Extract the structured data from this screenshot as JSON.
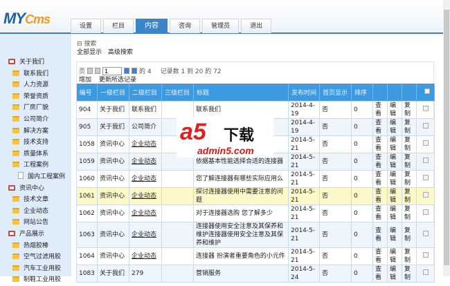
{
  "logo": {
    "my": "MY",
    "cms": "Cms"
  },
  "tabs": [
    "设置",
    "栏目",
    "内容",
    "咨询",
    "管理员",
    "退出"
  ],
  "sidebar": [
    {
      "label": "关于我们",
      "level": 1,
      "icon": "monitor-icon"
    },
    {
      "label": "联系我们",
      "level": 2,
      "icon": "folder-icon"
    },
    {
      "label": "人力资源",
      "level": 2,
      "icon": "folder-icon"
    },
    {
      "label": "荣誉资质",
      "level": 2,
      "icon": "folder-icon"
    },
    {
      "label": "厂房厂貌",
      "level": 2,
      "icon": "folder-icon"
    },
    {
      "label": "公司简介",
      "level": 2,
      "icon": "folder-icon"
    },
    {
      "label": "解决方案",
      "level": 2,
      "icon": "folder-icon"
    },
    {
      "label": "技术支持",
      "level": 2,
      "icon": "folder-icon"
    },
    {
      "label": "质量体系",
      "level": 2,
      "icon": "folder-icon"
    },
    {
      "label": "工程案例",
      "level": 2,
      "icon": "folder-icon"
    },
    {
      "label": "国内工程案例",
      "level": 3,
      "icon": "document-icon"
    },
    {
      "label": "资讯中心",
      "level": 1,
      "icon": "monitor-icon"
    },
    {
      "label": "技术文章",
      "level": 2,
      "icon": "folder-icon"
    },
    {
      "label": "企业动态",
      "level": 2,
      "icon": "folder-icon"
    },
    {
      "label": "网站公告",
      "level": 2,
      "icon": "folder-icon"
    },
    {
      "label": "产品展示",
      "level": 1,
      "icon": "monitor-icon"
    },
    {
      "label": "热熔胶棒",
      "level": 2,
      "icon": "folder-icon"
    },
    {
      "label": "空气过滤用胶",
      "level": 2,
      "icon": "folder-icon"
    },
    {
      "label": "汽车工业用胶",
      "level": 2,
      "icon": "folder-icon"
    },
    {
      "label": "制鞋工业用胶",
      "level": 2,
      "icon": "folder-icon"
    }
  ],
  "search": {
    "toggle": "⊟ 搜索",
    "show_all": "全部显示",
    "advanced": "高级搜索"
  },
  "pager": {
    "page_label": "页",
    "page": "1",
    "of": "的 4",
    "records": "记录数 1 到 20 的 72"
  },
  "actions": {
    "add": "增加",
    "update": "更新所选记录"
  },
  "table": {
    "headers": [
      "编号",
      "一级栏目",
      "二级栏目",
      "三级栏目",
      "标题",
      "发布时间",
      "首页显示",
      "排序",
      "",
      "",
      "",
      ""
    ],
    "rows": [
      {
        "id": "904",
        "c1": "关于我们",
        "c2": "联系我们",
        "c3": "",
        "title": "联系我们",
        "date": "2014-4-19",
        "home": "否",
        "order": "0"
      },
      {
        "id": "905",
        "c1": "关于我们",
        "c2": "公司简介",
        "c3": "",
        "title": "",
        "date": "2014-4-19",
        "home": "否",
        "order": "0"
      },
      {
        "id": "1058",
        "c1": "资讯中心",
        "c2": "企业动态",
        "c3": "",
        "title": "连",
        "date": "2014-5-21",
        "home": "否",
        "order": "0"
      },
      {
        "id": "1059",
        "c1": "资讯中心",
        "c2": "企业动态",
        "c3": "",
        "title": "依据基本性能选择合适的连接器",
        "date": "2014-5-21",
        "home": "否",
        "order": "0"
      },
      {
        "id": "1060",
        "c1": "资讯中心",
        "c2": "企业动态",
        "c3": "",
        "title": "您了解连接器有哪些实际应用么",
        "date": "2014-5-21",
        "home": "否",
        "order": "0"
      },
      {
        "id": "1061",
        "c1": "资讯中心",
        "c2": "企业动态",
        "c3": "",
        "title": "探讨连接器使用中需要注意的问题",
        "date": "2014-5-21",
        "home": "否",
        "order": "0"
      },
      {
        "id": "1062",
        "c1": "资讯中心",
        "c2": "企业动态",
        "c3": "",
        "title": "对于连接器选购 您了解多少",
        "date": "2014-5-21",
        "home": "否",
        "order": "0"
      },
      {
        "id": "1063",
        "c1": "资讯中心",
        "c2": "企业动态",
        "c3": "",
        "title": "连接器使用安全注意及其保养和维护连接器使用安全注意及其保养和维护",
        "date": "2014-5-21",
        "home": "否",
        "order": "0"
      },
      {
        "id": "1064",
        "c1": "资讯中心",
        "c2": "企业动态",
        "c3": "",
        "title": "连接器 扮演者重要角色的小元件",
        "date": "2014-5-21",
        "home": "否",
        "order": "0"
      },
      {
        "id": "1083",
        "c1": "关于我们",
        "c2": "279",
        "c3": "",
        "title": "营销服务",
        "date": "2014-5-24",
        "home": "否",
        "order": "0"
      }
    ],
    "row_actions": {
      "view": "查看",
      "edit": "编辑",
      "copy": "复制"
    }
  },
  "watermark": {
    "brand": "a5",
    "text": "下载",
    "url": "admin5.com"
  }
}
